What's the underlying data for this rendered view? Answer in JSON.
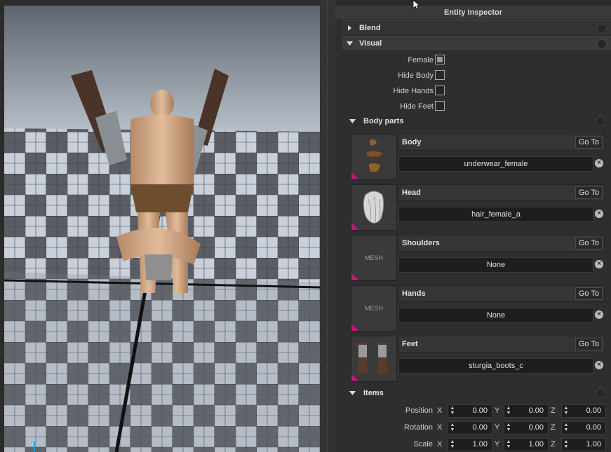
{
  "inspector": {
    "title": "Entity Inspector",
    "sections": {
      "blend": "Blend",
      "visual": "Visual",
      "body_parts": "Body parts",
      "items": "Items"
    },
    "flags": [
      {
        "label": "Female",
        "checked": true
      },
      {
        "label": "Hide Body",
        "checked": false
      },
      {
        "label": "Hide Hands",
        "checked": false
      },
      {
        "label": "Hide Feet",
        "checked": false
      }
    ],
    "parts": [
      {
        "name": "Body",
        "goto": "Go To",
        "value": "underwear_female",
        "thumb": "body-mesh-thumbnail"
      },
      {
        "name": "Head",
        "goto": "Go To",
        "value": "hair_female_a",
        "thumb": "hair-mesh-thumbnail"
      },
      {
        "name": "Shoulders",
        "goto": "Go To",
        "value": "None",
        "thumb": "MESH"
      },
      {
        "name": "Hands",
        "goto": "Go To",
        "value": "None",
        "thumb": "MESH"
      },
      {
        "name": "Feet",
        "goto": "Go To",
        "value": "sturgia_boots_c",
        "thumb": "boots-mesh-thumbnail"
      }
    ],
    "transform": [
      {
        "label": "Position",
        "x": "0.00",
        "y": "0.00",
        "z": "0.00"
      },
      {
        "label": "Rotation",
        "x": "0.00",
        "y": "0.00",
        "z": "0.00"
      },
      {
        "label": "Scale",
        "x": "1.00",
        "y": "1.00",
        "z": "1.00"
      }
    ],
    "axes": {
      "x": "X",
      "y": "Y",
      "z": "Z"
    }
  },
  "colors": {
    "accent_triangle": "#c2187a",
    "panel": "#2e2e2e",
    "header": "#3b3b3b"
  }
}
